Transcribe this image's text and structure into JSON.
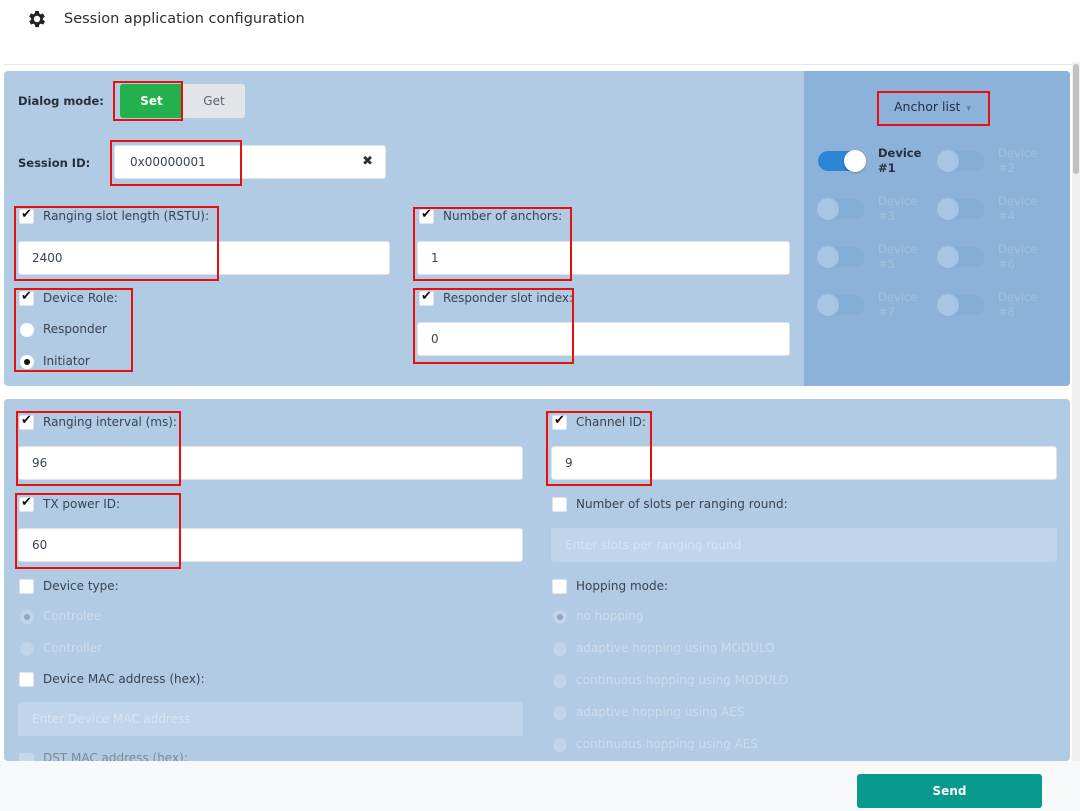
{
  "header": {
    "icon": "gear-icon",
    "title": "Session application configuration"
  },
  "dialog_mode": {
    "label": "Dialog mode:",
    "options": [
      "Set",
      "Get"
    ],
    "selected": "Set"
  },
  "session_id": {
    "label": "Session ID:",
    "value": "0x00000001",
    "clear_icon": "✖"
  },
  "ranging_slot_length": {
    "label": "Ranging slot length (RSTU):",
    "checked": true,
    "value": "2400"
  },
  "number_of_anchors": {
    "label": "Number of anchors:",
    "checked": true,
    "value": "1"
  },
  "device_role": {
    "label": "Device Role:",
    "checked": true,
    "options": [
      "Responder",
      "Initiator"
    ],
    "selected": "Initiator"
  },
  "responder_slot_index": {
    "label": "Responder slot index:",
    "checked": true,
    "value": "0"
  },
  "anchor_list": {
    "label": "Anchor list",
    "caret": "▾",
    "devices": [
      {
        "line1": "Device",
        "line2": "#1",
        "enabled": true
      },
      {
        "line1": "Device",
        "line2": "#2",
        "enabled": false
      },
      {
        "line1": "Device",
        "line2": "#3",
        "enabled": false
      },
      {
        "line1": "Device",
        "line2": "#4",
        "enabled": false
      },
      {
        "line1": "Device",
        "line2": "#5",
        "enabled": false
      },
      {
        "line1": "Device",
        "line2": "#6",
        "enabled": false
      },
      {
        "line1": "Device",
        "line2": "#7",
        "enabled": false
      },
      {
        "line1": "Device",
        "line2": "#8",
        "enabled": false
      }
    ]
  },
  "ranging_interval": {
    "label": "Ranging interval (ms):",
    "checked": true,
    "value": "96"
  },
  "channel_id": {
    "label": "Channel ID:",
    "checked": true,
    "value": "9"
  },
  "tx_power_id": {
    "label": "TX power ID:",
    "checked": true,
    "value": "60"
  },
  "slots_per_round": {
    "label": "Number of slots per ranging round:",
    "checked": false,
    "placeholder": "Enter slots per ranging round"
  },
  "device_type": {
    "label": "Device type:",
    "checked": false,
    "options": [
      "Controlee",
      "Controller"
    ],
    "selected": "Controlee"
  },
  "hopping_mode": {
    "label": "Hopping mode:",
    "checked": false,
    "options": [
      "no hopping",
      "adaptive hopping using MODULO",
      "continuous hopping using MODULO",
      "adaptive hopping using AES",
      "continuous hopping using AES"
    ],
    "selected": "no hopping"
  },
  "device_mac": {
    "label": "Device MAC address (hex):",
    "checked": false,
    "placeholder": "Enter Device MAC address"
  },
  "dst_mac": {
    "label": "DST MAC address (hex):",
    "checked": false
  },
  "footer": {
    "send_label": "Send"
  }
}
